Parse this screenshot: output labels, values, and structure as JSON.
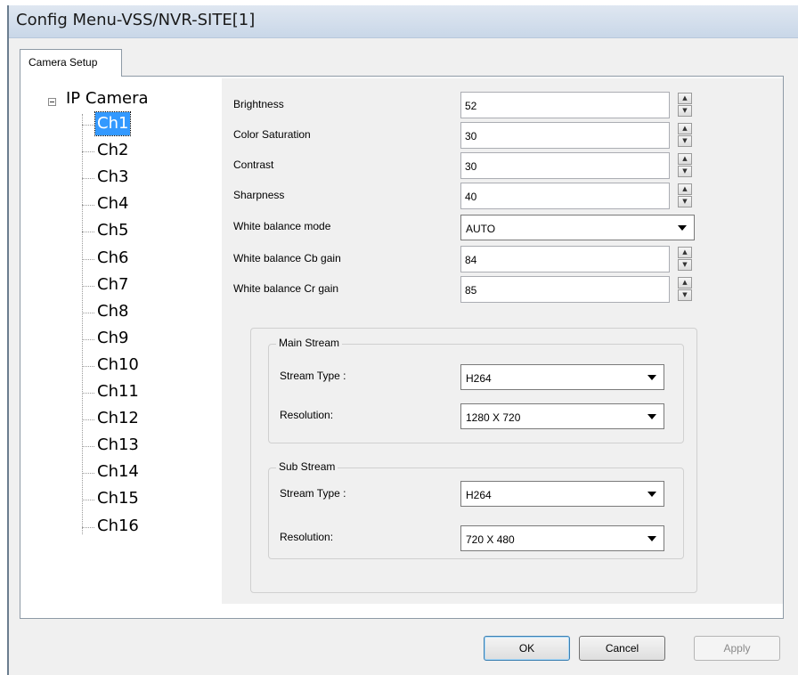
{
  "window": {
    "title": "Config Menu-VSS/NVR-SITE[1]"
  },
  "tabs": [
    {
      "label": "Camera Setup",
      "active": true
    }
  ],
  "tree": {
    "root": "IP Camera",
    "items": [
      "Ch1",
      "Ch2",
      "Ch3",
      "Ch4",
      "Ch5",
      "Ch6",
      "Ch7",
      "Ch8",
      "Ch9",
      "Ch10",
      "Ch11",
      "Ch12",
      "Ch13",
      "Ch14",
      "Ch15",
      "Ch16"
    ],
    "selected": "Ch1"
  },
  "image_settings": {
    "brightness": {
      "label": "Brightness",
      "value": "52"
    },
    "color_saturation": {
      "label": "Color Saturation",
      "value": "30"
    },
    "contrast": {
      "label": "Contrast",
      "value": "30"
    },
    "sharpness": {
      "label": "Sharpness",
      "value": "40"
    },
    "white_balance_mode": {
      "label": "White balance mode",
      "value": "AUTO"
    },
    "wb_cb_gain": {
      "label": "White balance Cb gain",
      "value": "84"
    },
    "wb_cr_gain": {
      "label": "White balance Cr gain",
      "value": "85"
    }
  },
  "main_stream": {
    "title": "Main Stream",
    "stream_type_label": "Stream Type :",
    "stream_type": "H264",
    "resolution_label": "Resolution:",
    "resolution": "1280 X 720"
  },
  "sub_stream": {
    "title": "Sub Stream",
    "stream_type_label": "Stream Type :",
    "stream_type": "H264",
    "resolution_label": "Resolution:",
    "resolution": "720 X 480"
  },
  "buttons": {
    "ok": "OK",
    "cancel": "Cancel",
    "apply": "Apply"
  },
  "colors": {
    "selection": "#3399ff",
    "default_button_border": "#3c7fb1"
  }
}
